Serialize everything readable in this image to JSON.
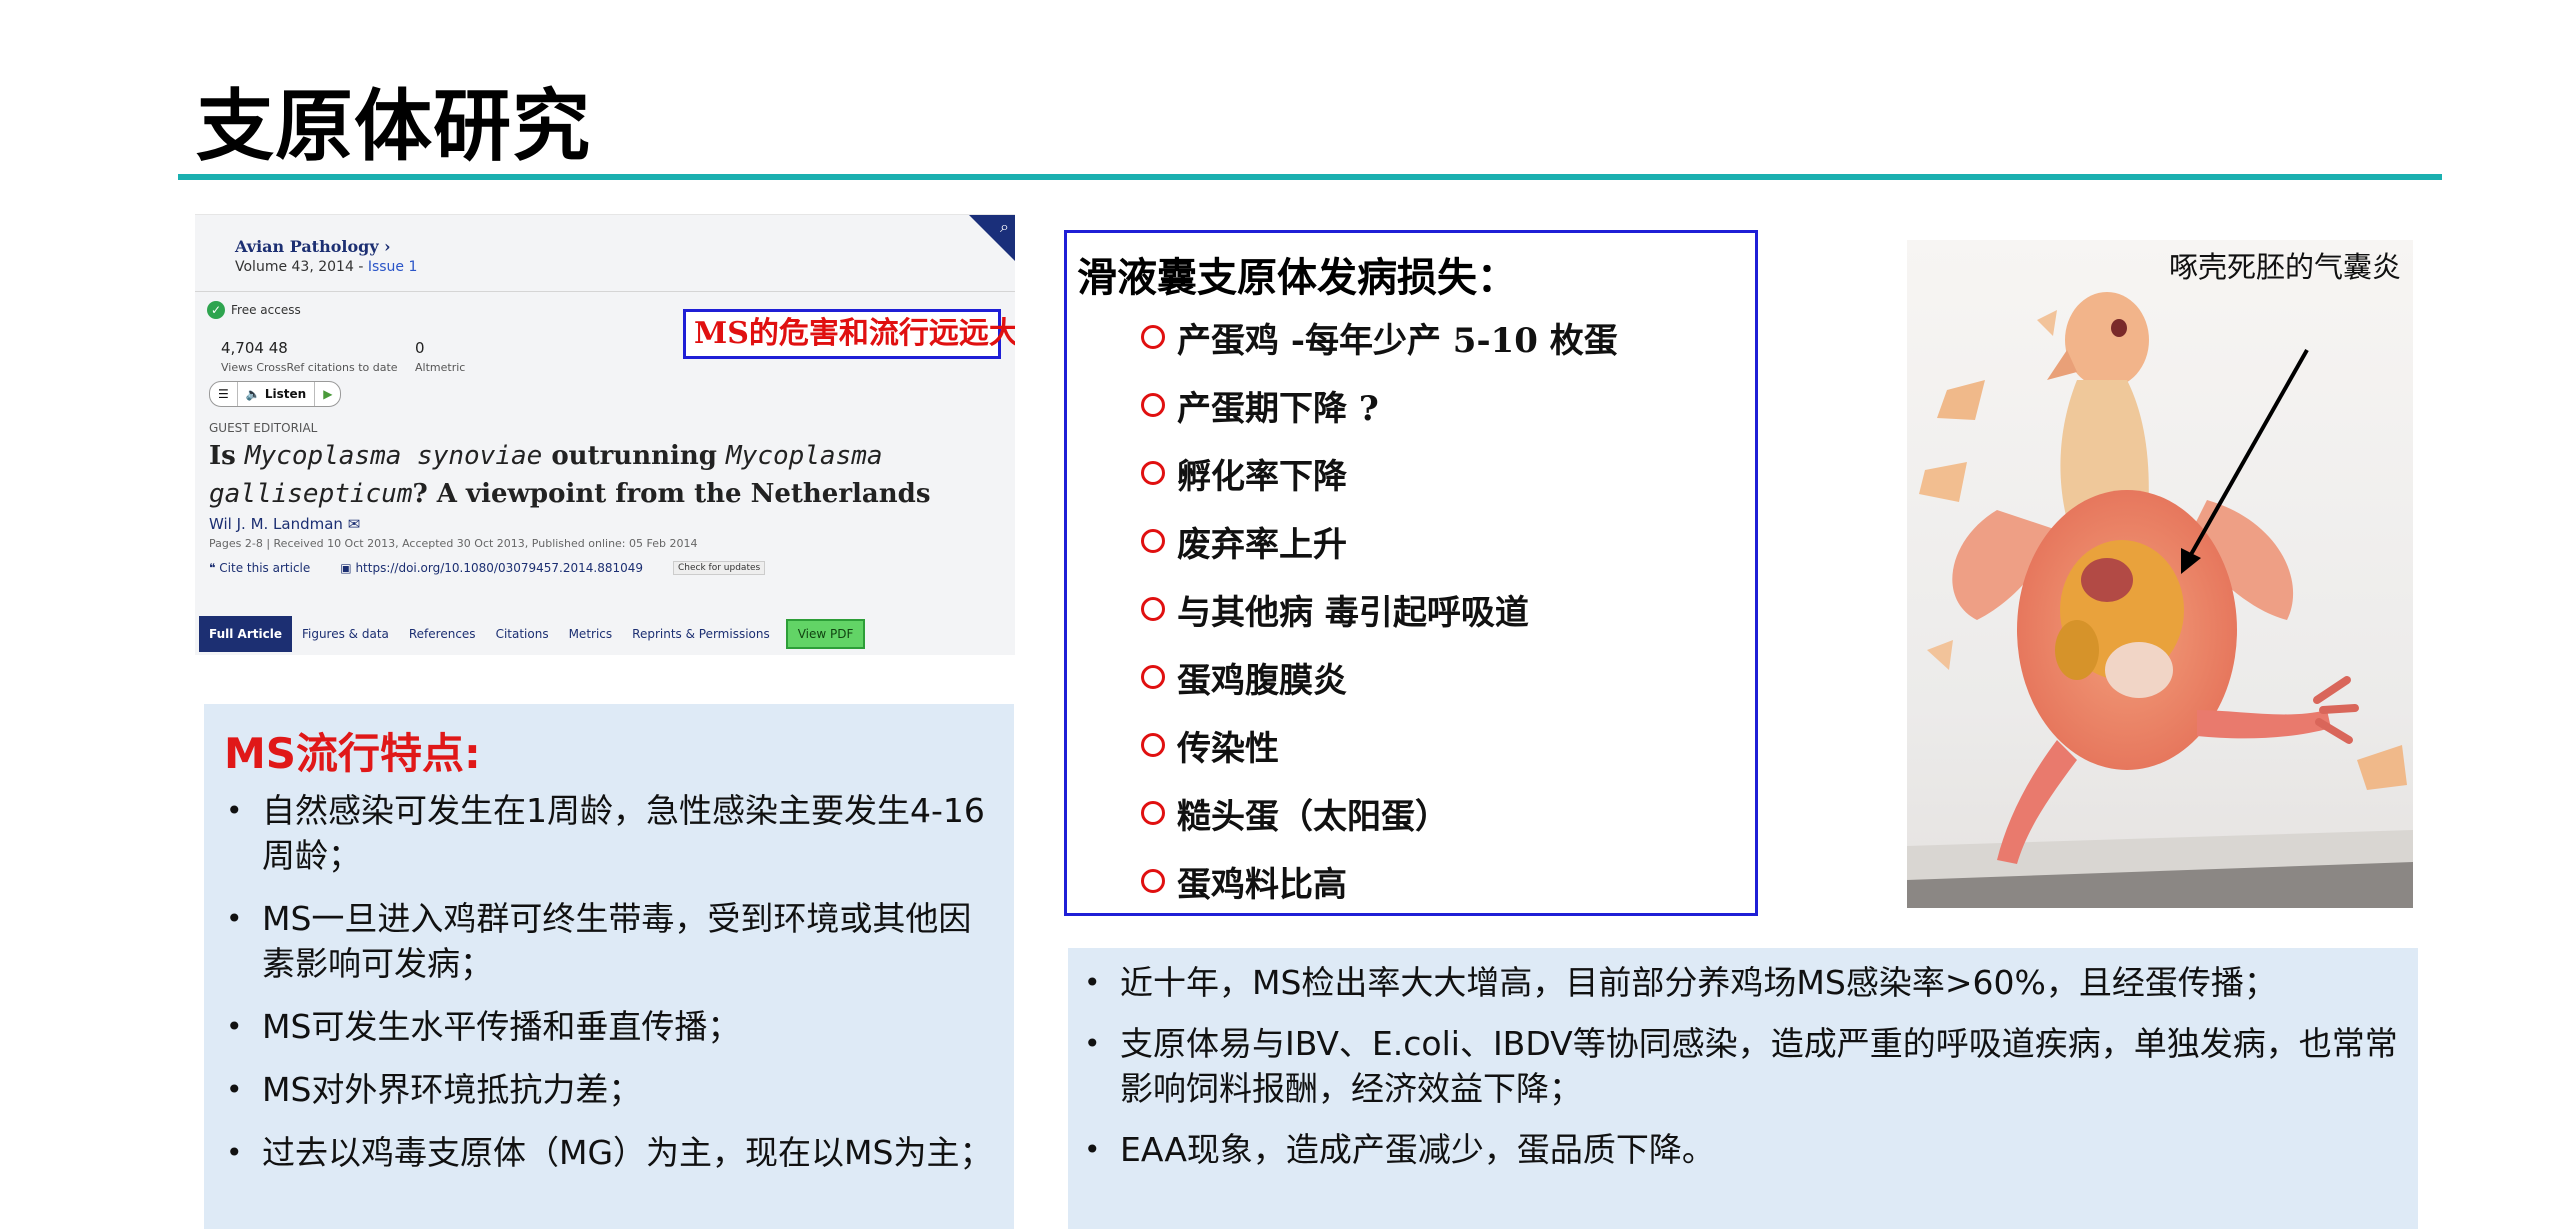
{
  "page": {
    "title": "支原体研究"
  },
  "article": {
    "journal": "Avian Pathology ›",
    "volume_prefix": "Volume 43, 2014 - ",
    "issue": "Issue 1",
    "access": "Free access",
    "views_line": "4,704  48",
    "metrics_labels": "Views    CrossRef citations to date",
    "altmetric_value": "0",
    "altmetric_label": "Altmetric",
    "listen_label": "Listen",
    "section": "GUEST EDITORIAL",
    "headline_is": "Is ",
    "headline_species1": "Mycoplasma synoviae",
    "headline_mid": " outrunning ",
    "headline_species2": "Mycoplasma gallisepticum",
    "headline_tail": "? A viewpoint from the Netherlands",
    "author": "Wil J. M. Landman",
    "pages_line": "Pages 2-8 | Received 10 Oct 2013, Accepted 30 Oct 2013, Published online: 05 Feb 2014",
    "cite_label": "Cite this article",
    "doi": "https://doi.org/10.1080/03079457.2014.881049",
    "check_updates": "Check for updates",
    "tabs": [
      "Full Article",
      "Figures & data",
      "References",
      "Citations",
      "Metrics",
      "Reprints & Permissions",
      "View PDF"
    ],
    "callout": "MS的危害和流行远远大于MG"
  },
  "ms_features": {
    "heading": "MS流行特点:",
    "items": [
      "自然感染可发生在1周龄，急性感染主要发生4-16周龄；",
      "MS一旦进入鸡群可终生带毒，受到环境或其他因素影响可发病；",
      "MS可发生水平传播和垂直传播；",
      "MS对外界环境抵抗力差；",
      "过去以鸡毒支原体（MG）为主，现在以MS为主；"
    ]
  },
  "losses": {
    "title": "滑液囊支原体发病损失：",
    "items": [
      "产蛋鸡 -每年少产 5-10 枚蛋",
      "产蛋期下降 ?",
      "孵化率下降",
      "废弃率上升",
      "与其他病 毒引起呼吸道",
      "蛋鸡腹膜炎",
      "传染性",
      "糙头蛋（太阳蛋）",
      "蛋鸡料比高"
    ]
  },
  "photo": {
    "label": "啄壳死胚的气囊炎"
  },
  "bottom_notes": {
    "items": [
      "近十年，MS检出率大大增高，目前部分养鸡场MS感染率>60%，且经蛋传播；",
      "支原体易与IBV、E.coli、IBDV等协同感染，造成严重的呼吸道疾病，单独发病，也常常影响饲料报酬，经济效益下降；",
      "EAA现象，造成产蛋减少，蛋品质下降。"
    ]
  },
  "colors": {
    "accent_rule": "#1ab0b0",
    "callout_border": "#1f1fd6",
    "highlight_red": "#e01010",
    "panel_bg": "#deeaf6"
  }
}
